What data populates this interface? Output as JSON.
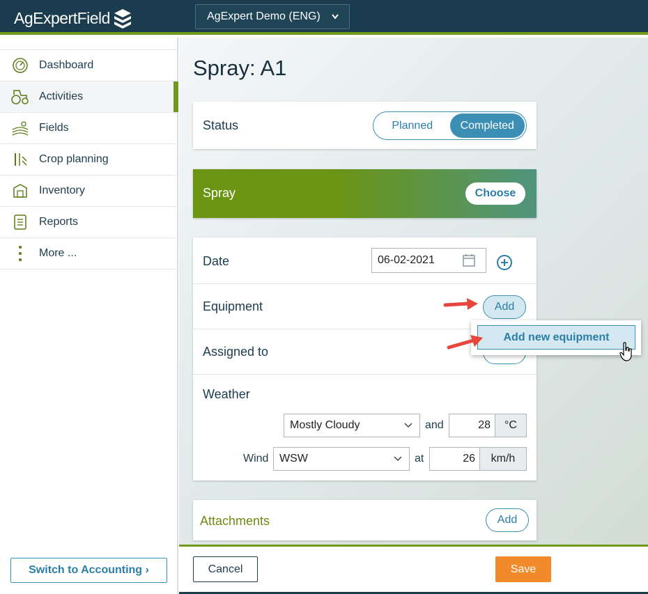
{
  "app": {
    "brand_primary": "AgExpert",
    "brand_secondary": "Field",
    "org_selector": "AgExpert Demo (ENG)"
  },
  "sidebar": {
    "items": [
      {
        "label": "Dashboard",
        "icon": "dashboard-icon"
      },
      {
        "label": "Activities",
        "icon": "tractor-icon",
        "active": true
      },
      {
        "label": "Fields",
        "icon": "field-icon"
      },
      {
        "label": "Crop planning",
        "icon": "crop-planning-icon"
      },
      {
        "label": "Inventory",
        "icon": "inventory-icon"
      },
      {
        "label": "Reports",
        "icon": "reports-icon"
      },
      {
        "label": "More ...",
        "icon": "more-vertical-icon"
      }
    ],
    "switch_button": "Switch to Accounting ›"
  },
  "page": {
    "title": "Spray: A1",
    "status": {
      "label": "Status",
      "options": [
        "Planned",
        "Completed"
      ],
      "selected": "Completed"
    },
    "spray": {
      "title": "Spray",
      "choose_label": "Choose"
    },
    "date": {
      "label": "Date",
      "value": "06-02-2021"
    },
    "equipment": {
      "label": "Equipment",
      "add_label": "Add"
    },
    "assigned": {
      "label": "Assigned to"
    },
    "weather": {
      "label": "Weather",
      "condition": "Mostly Cloudy",
      "and_label": "and",
      "temperature": "28",
      "temp_unit": "°C",
      "wind_label": "Wind",
      "wind_direction": "WSW",
      "at_label": "at",
      "wind_speed": "26",
      "speed_unit": "km/h"
    },
    "attachments": {
      "title": "Attachments",
      "add_label": "Add"
    },
    "popup": {
      "item": "Add new equipment"
    }
  },
  "footer": {
    "cancel_label": "Cancel",
    "save_label": "Save"
  },
  "colors": {
    "topbar": "#1a3c4e",
    "accent_green": "#6f9a1a",
    "accent_blue": "#3b8fb4",
    "save_orange": "#f08a2a"
  }
}
